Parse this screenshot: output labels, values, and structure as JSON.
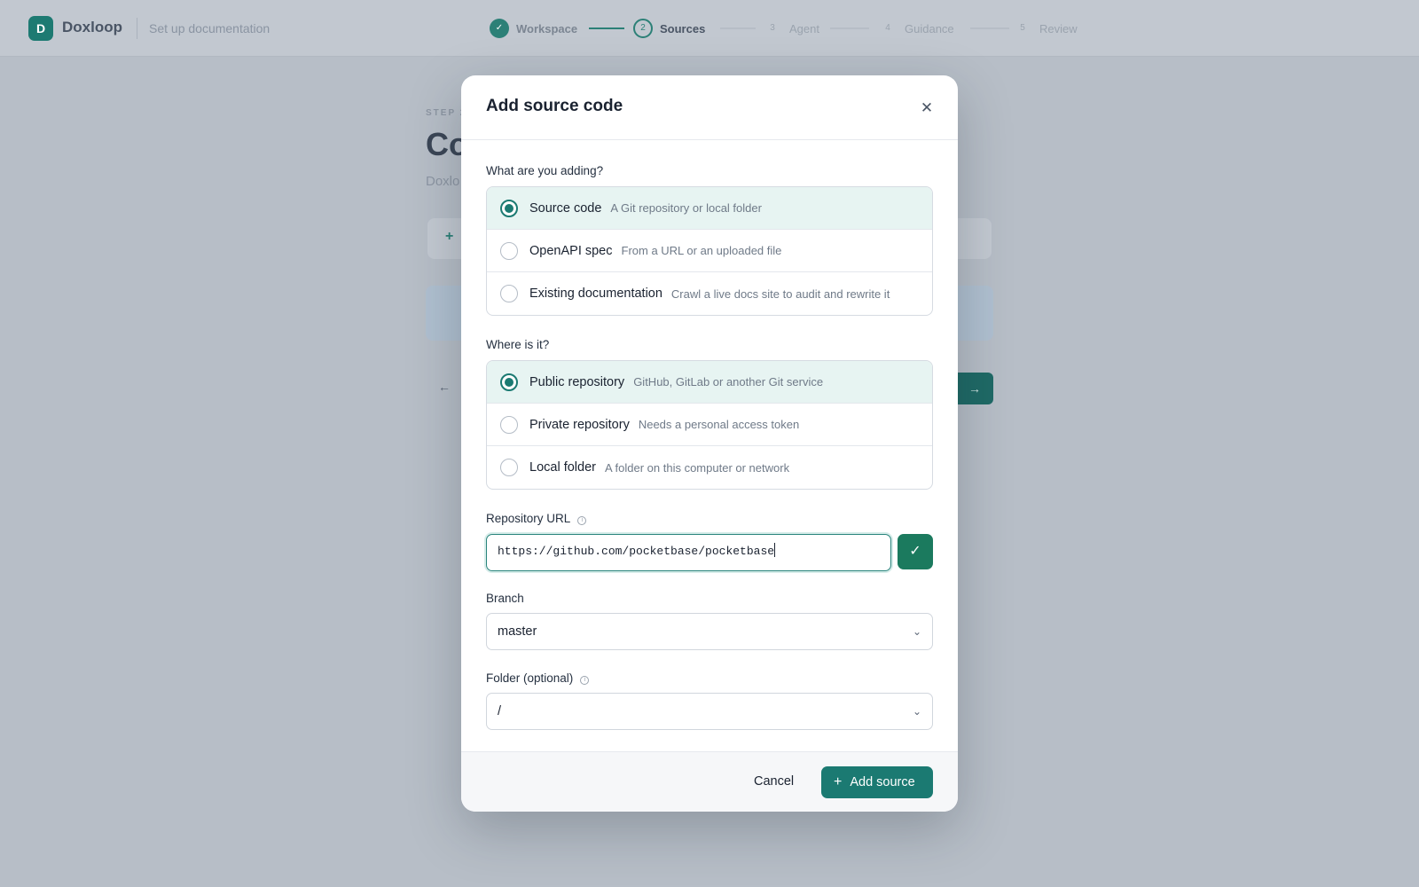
{
  "app": {
    "brand": "Doxloop",
    "logo_letter": "D",
    "subtitle": "Set up documentation"
  },
  "steps": [
    {
      "label": "Workspace",
      "marker": "✓",
      "state": "done"
    },
    {
      "label": "Sources",
      "marker": "2",
      "state": "current"
    },
    {
      "label": "Agent",
      "marker": "3",
      "state": "next"
    },
    {
      "label": "Guidance",
      "marker": "4",
      "state": "next"
    },
    {
      "label": "Review",
      "marker": "5",
      "state": "next"
    }
  ],
  "background": {
    "step_label": "STEP 2",
    "title_fragment": "Co",
    "desc_fragment": "Doxlo"
  },
  "modal": {
    "title": "Add source code",
    "what_label": "What are you adding?",
    "source_types": [
      {
        "title": "Source code",
        "desc": "A Git repository or local folder",
        "selected": true
      },
      {
        "title": "OpenAPI spec",
        "desc": "From a URL or an uploaded file",
        "selected": false
      },
      {
        "title": "Existing documentation",
        "desc": "Crawl a live docs site to audit and rewrite it",
        "selected": false
      }
    ],
    "where_label": "Where is it?",
    "locations": [
      {
        "title": "Public repository",
        "desc": "GitHub, GitLab or another Git service",
        "selected": true
      },
      {
        "title": "Private repository",
        "desc": "Needs a personal access token",
        "selected": false
      },
      {
        "title": "Local folder",
        "desc": "A folder on this computer or network",
        "selected": false
      }
    ],
    "repo_url_label": "Repository URL",
    "repo_url_value": "https://github.com/pocketbase/pocketbase",
    "branch_label": "Branch",
    "branch_value": "master",
    "folder_label": "Folder (optional)",
    "folder_value": "/",
    "cancel_label": "Cancel",
    "add_label": "Add source"
  },
  "colors": {
    "accent": "#1b7a72",
    "selected_bg": "#e7f4f2",
    "overlay": "#b7bec7"
  },
  "icons": {
    "close": "close-icon",
    "check": "check-icon",
    "chevron": "chevron-down-icon",
    "plus": "plus-icon",
    "info": "info-icon"
  }
}
